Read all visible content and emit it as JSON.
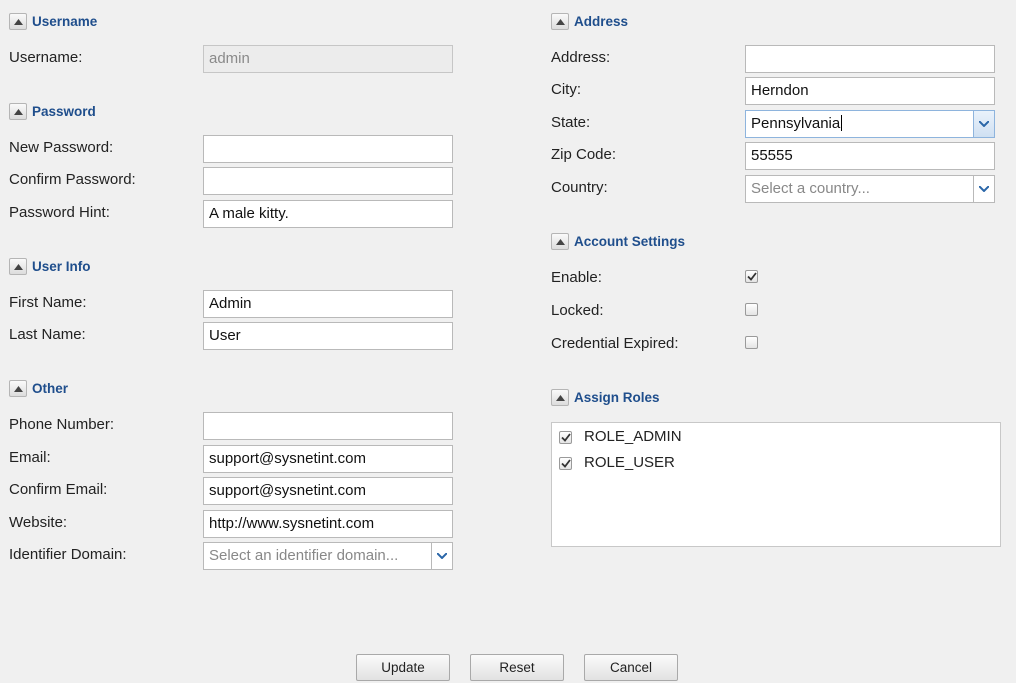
{
  "icons": {
    "collapse": "chevron-up-icon",
    "combo": "chevron-down-icon",
    "check": "check-icon"
  },
  "colors": {
    "section_title": "#1f4e8c",
    "background": "#f0f0f0",
    "combo_arrow": "#2a66a8"
  },
  "username_section": {
    "title": "Username",
    "username_label": "Username:",
    "username_value": "admin"
  },
  "password_section": {
    "title": "Password",
    "new_password_label": "New Password:",
    "new_password_value": "",
    "confirm_password_label": "Confirm Password:",
    "confirm_password_value": "",
    "hint_label": "Password Hint:",
    "hint_value": "A male kitty."
  },
  "user_info_section": {
    "title": "User Info",
    "first_name_label": "First Name:",
    "first_name_value": "Admin",
    "last_name_label": "Last Name:",
    "last_name_value": "User"
  },
  "other_section": {
    "title": "Other",
    "phone_label": "Phone Number:",
    "phone_value": "",
    "email_label": "Email:",
    "email_value": "support@sysnetint.com",
    "confirm_email_label": "Confirm Email:",
    "confirm_email_value": "support@sysnetint.com",
    "website_label": "Website:",
    "website_value": "http://www.sysnetint.com",
    "identifier_domain_label": "Identifier Domain:",
    "identifier_domain_placeholder": "Select an identifier domain..."
  },
  "address_section": {
    "title": "Address",
    "address_label": "Address:",
    "address_value": "",
    "city_label": "City:",
    "city_value": "Herndon",
    "state_label": "State:",
    "state_value": "Pennsylvania",
    "zip_label": "Zip Code:",
    "zip_value": "55555",
    "country_label": "Country:",
    "country_placeholder": "Select a country..."
  },
  "account_settings_section": {
    "title": "Account Settings",
    "enable_label": "Enable:",
    "enable_checked": true,
    "locked_label": "Locked:",
    "locked_checked": false,
    "credential_expired_label": "Credential Expired:",
    "credential_expired_checked": false
  },
  "roles_section": {
    "title": "Assign Roles",
    "roles": [
      {
        "label": "ROLE_ADMIN",
        "checked": true
      },
      {
        "label": "ROLE_USER",
        "checked": true
      }
    ]
  },
  "buttons": {
    "update": "Update",
    "reset": "Reset",
    "cancel": "Cancel"
  }
}
